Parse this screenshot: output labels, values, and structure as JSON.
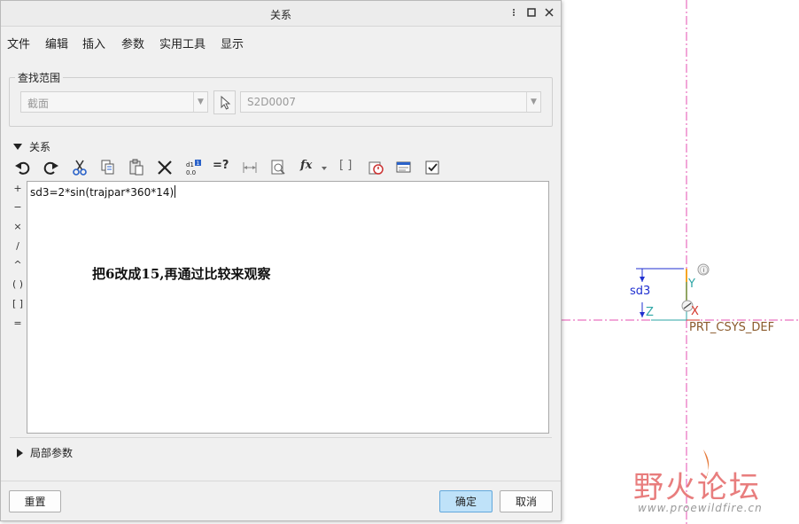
{
  "dialog": {
    "title": "关系",
    "menu": [
      "文件",
      "编辑",
      "插入",
      "参数",
      "实用工具",
      "显示"
    ],
    "search_scope": {
      "legend": "查找范围",
      "type_value": "截面",
      "object_value": "S2D0007"
    },
    "relations_header": "关系",
    "toolbar_icons": [
      "undo-icon",
      "redo-icon",
      "cut-icon",
      "copy-icon",
      "paste-icon",
      "delete-icon",
      "sort-relations-icon",
      "evaluate-icon",
      "insert-dimension-icon",
      "insert-parameter-icon",
      "insert-function-icon",
      "function-dropdown-icon",
      "brackets-icon",
      "verify-relations-icon",
      "show-dimensions-icon",
      "checklist-icon"
    ],
    "toolbar_texts": {
      "evaluate": "=?",
      "fx": "fx",
      "brackets": "[ ]"
    },
    "operators": [
      "+",
      "−",
      "×",
      "/",
      "^",
      "( )",
      "[ ]",
      "="
    ],
    "editor_text": "sd3=2*sin(trajpar*360*14)",
    "annotation": "把6改成15,再通过比较来观察",
    "local_params_header": "局部参数",
    "buttons": {
      "reset": "重置",
      "ok": "确定",
      "cancel": "取消"
    }
  },
  "sketch": {
    "dimension_label": "sd3",
    "axis_y": "Y",
    "axis_z": "Z",
    "axis_x": "X",
    "csys_label": "PRT_CSYS_DEF",
    "colors": {
      "centerline": "#e64fb1",
      "accent_x": "#d4372b",
      "axis": "#2ea6a6",
      "dim": "#1f2fd0",
      "orange": "#f5a623"
    }
  },
  "watermark": {
    "title": "野火论坛",
    "url": "www.proewildfire.cn"
  }
}
